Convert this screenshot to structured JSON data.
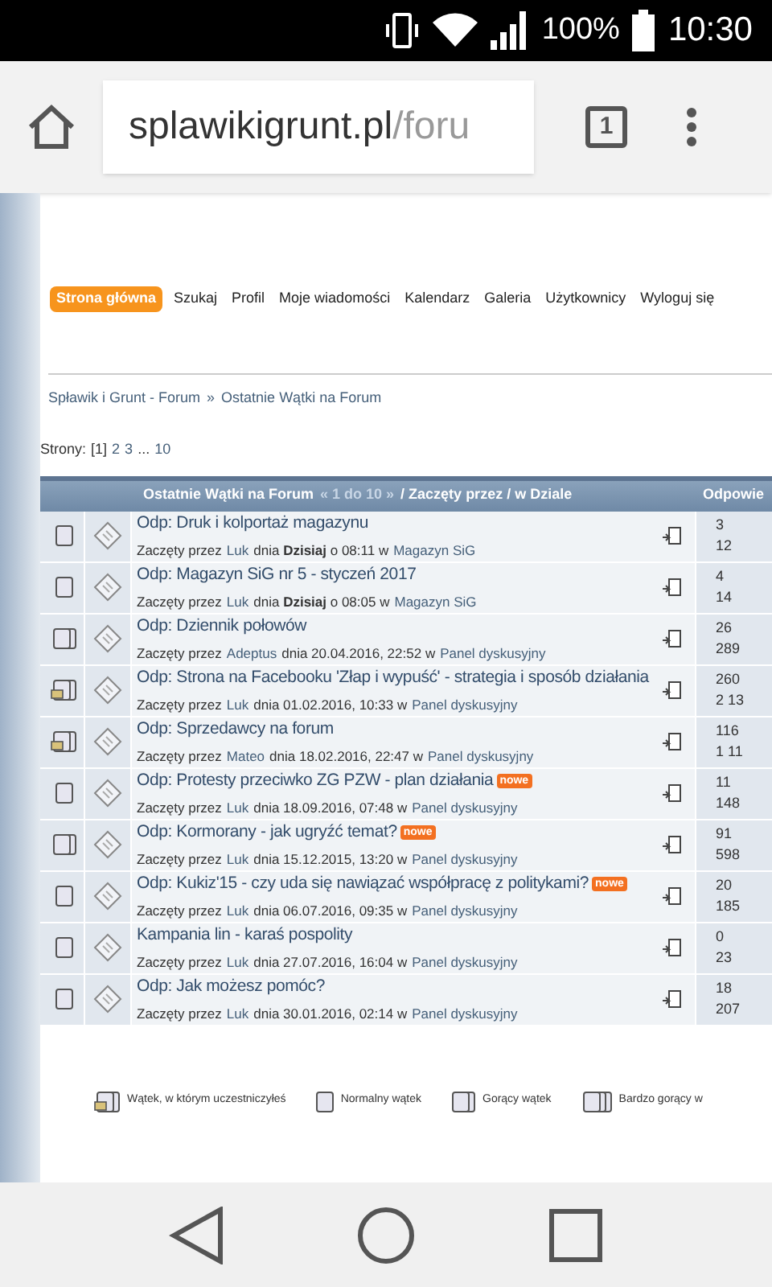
{
  "status_bar": {
    "battery": "100%",
    "time": "10:30"
  },
  "browser": {
    "domain": "splawikigrunt.pl",
    "path": "/foru",
    "tab_count": "1"
  },
  "nav": [
    {
      "label": "Strona główna",
      "selected": true
    },
    {
      "label": "Szukaj",
      "selected": false
    },
    {
      "label": "Profil",
      "selected": false
    },
    {
      "label": "Moje wiadomości",
      "selected": false
    },
    {
      "label": "Kalendarz",
      "selected": false
    },
    {
      "label": "Galeria",
      "selected": false
    },
    {
      "label": "Użytkownicy",
      "selected": false
    },
    {
      "label": "Wyloguj się",
      "selected": false
    }
  ],
  "breadcrumb": [
    "Spławik i Grunt - Forum",
    "»",
    "Ostatnie Wątki na Forum"
  ],
  "pagination": {
    "label": "Strony:",
    "current": "[1]",
    "pages": [
      "2",
      "3"
    ],
    "ellipsis": "...",
    "last": "10"
  },
  "table": {
    "header": {
      "title": "Ostatnie Wątki na Forum",
      "range": "« 1 do 10 »",
      "rest": "/ Zaczęty przez / w Dziale",
      "column_3": "Odpowie"
    },
    "rows": [
      {
        "kind": "normal",
        "title": "Odp: Druk i kolportaż magazynu",
        "prefix": "Zaczęty przez",
        "author": "Luk",
        "when": "dnia **Dzisiaj** o 08:11 w",
        "board": "Magazyn SiG",
        "replies": "3",
        "views": "12"
      },
      {
        "kind": "normal",
        "title": "Odp: Magazyn SiG nr 5 - styczeń 2017",
        "prefix": "Zaczęty przez",
        "author": "Luk",
        "when": "dnia **Dzisiaj** o 08:05 w",
        "board": "Magazyn SiG",
        "replies": "4",
        "views": "14"
      },
      {
        "kind": "hot",
        "title": "Odp: Dziennik połowów",
        "prefix": "Zaczęty przez",
        "author": "Adeptus",
        "when": "dnia 20.04.2016, 22:52 w",
        "board": "Panel dyskusyjny",
        "replies": "26",
        "views": "289"
      },
      {
        "kind": "participated",
        "title": "Odp: Strona na Facebooku 'Złap i wypuść' - strategia i sposób działania",
        "prefix": "Zaczęty przez",
        "author": "Luk",
        "when": "dnia 01.02.2016, 10:33 w",
        "board": "Panel dyskusyjny",
        "replies": "260",
        "views": "2 13"
      },
      {
        "kind": "participated",
        "title": "Odp: Sprzedawcy na forum",
        "prefix": "Zaczęty przez",
        "author": "Mateo",
        "when": "dnia 18.02.2016, 22:47 w",
        "board": "Panel dyskusyjny",
        "replies": "116",
        "views": "1 11"
      },
      {
        "kind": "normal",
        "title": "Odp: Protesty przeciwko ZG PZW - plan działania",
        "new_label": "nowe",
        "prefix": "Zaczęty przez",
        "author": "Luk",
        "when": "dnia 18.09.2016, 07:48 w",
        "board": "Panel dyskusyjny",
        "replies": "11",
        "views": "148"
      },
      {
        "kind": "hot",
        "title": "Odp: Kormorany - jak ugryźć temat?",
        "new_label": "nowe",
        "prefix": "Zaczęty przez",
        "author": "Luk",
        "when": "dnia 15.12.2015, 13:20 w",
        "board": "Panel dyskusyjny",
        "replies": "91",
        "views": "598"
      },
      {
        "kind": "normal",
        "title": "Odp: Kukiz'15 - czy uda się nawiązać współpracę z politykami?",
        "new_label": "nowe",
        "prefix": "Zaczęty przez",
        "author": "Luk",
        "when": "dnia 06.07.2016, 09:35 w",
        "board": "Panel dyskusyjny",
        "replies": "20",
        "views": "185"
      },
      {
        "kind": "normal",
        "title": "Kampania lin - karaś pospolity",
        "prefix": "Zaczęty przez",
        "author": "Luk",
        "when": "dnia 27.07.2016, 16:04 w",
        "board": "Panel dyskusyjny",
        "replies": "0",
        "views": "23"
      },
      {
        "kind": "normal",
        "title": "Odp: Jak możesz pomóc?",
        "prefix": "Zaczęty przez",
        "author": "Luk",
        "when": "dnia 30.01.2016, 02:14 w",
        "board": "Panel dyskusyjny",
        "replies": "18",
        "views": "207"
      }
    ]
  },
  "legend": [
    {
      "kind": "participated",
      "label": "Wątek, w którym uczestniczyłeś"
    },
    {
      "kind": "normal",
      "label": "Normalny wątek"
    },
    {
      "kind": "hot",
      "label": "Gorący wątek"
    },
    {
      "kind": "veryhot",
      "label": "Bardzo gorący w"
    }
  ]
}
